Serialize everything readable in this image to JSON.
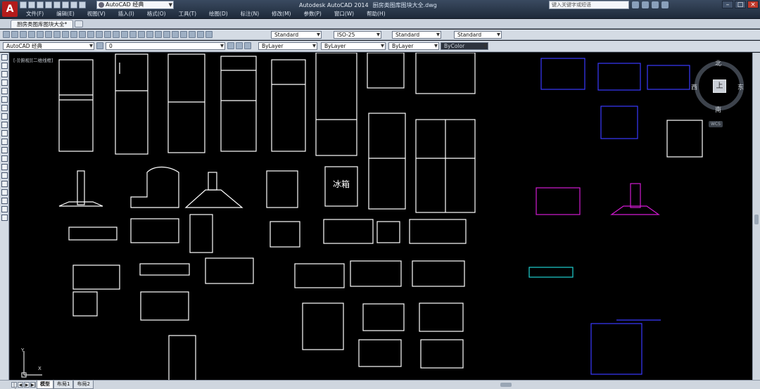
{
  "title_bar": {
    "logo_letter": "A",
    "workspace": "AutoCAD 经典",
    "app_title": "Autodesk AutoCAD 2014",
    "file_name": "厨房类图库图块大全.dwg",
    "search_placeholder": "键入关键字或短语"
  },
  "window_controls": {
    "minimize": "–",
    "restore": "□",
    "close": "×"
  },
  "menus": [
    "文件(F)",
    "编辑(E)",
    "视图(V)",
    "插入(I)",
    "格式(O)",
    "工具(T)",
    "绘图(D)",
    "标注(N)",
    "修改(M)",
    "参数(P)",
    "窗口(W)",
    "帮助(H)"
  ],
  "drawing_tab": "厨房类图库图块大全*",
  "toolbar1": {
    "text_style": "Standard",
    "dim_style": "ISO-25",
    "table_style": "Standard",
    "mleader_style": "Standard"
  },
  "toolbar2": {
    "workspace": "AutoCAD 经典",
    "layer": "0",
    "color": "ByLayer",
    "linetype": "ByLayer",
    "lineweight": "ByLayer",
    "plotstyle": "ByColor"
  },
  "viewport_label": "[-][俯视][二维线框]",
  "block_text": {
    "fridge_label": "冰箱"
  },
  "viewcube": {
    "north": "北",
    "south": "南",
    "east": "东",
    "west": "西",
    "face": "上",
    "wcs": "WCS"
  },
  "ucs": {
    "x": "X",
    "y": "Y"
  },
  "layout_nav": [
    "|◀",
    "◀",
    "▶",
    "▶|"
  ],
  "layout_tabs": [
    "模型",
    "布局1",
    "布局2"
  ],
  "active_layout": "模型",
  "colors": {
    "canvas": "#000000",
    "blocks": "#ffffff",
    "accent_blue": "#3a3aff",
    "accent_magenta": "#d21ad2",
    "accent_cyan": "#1fd0d0"
  }
}
